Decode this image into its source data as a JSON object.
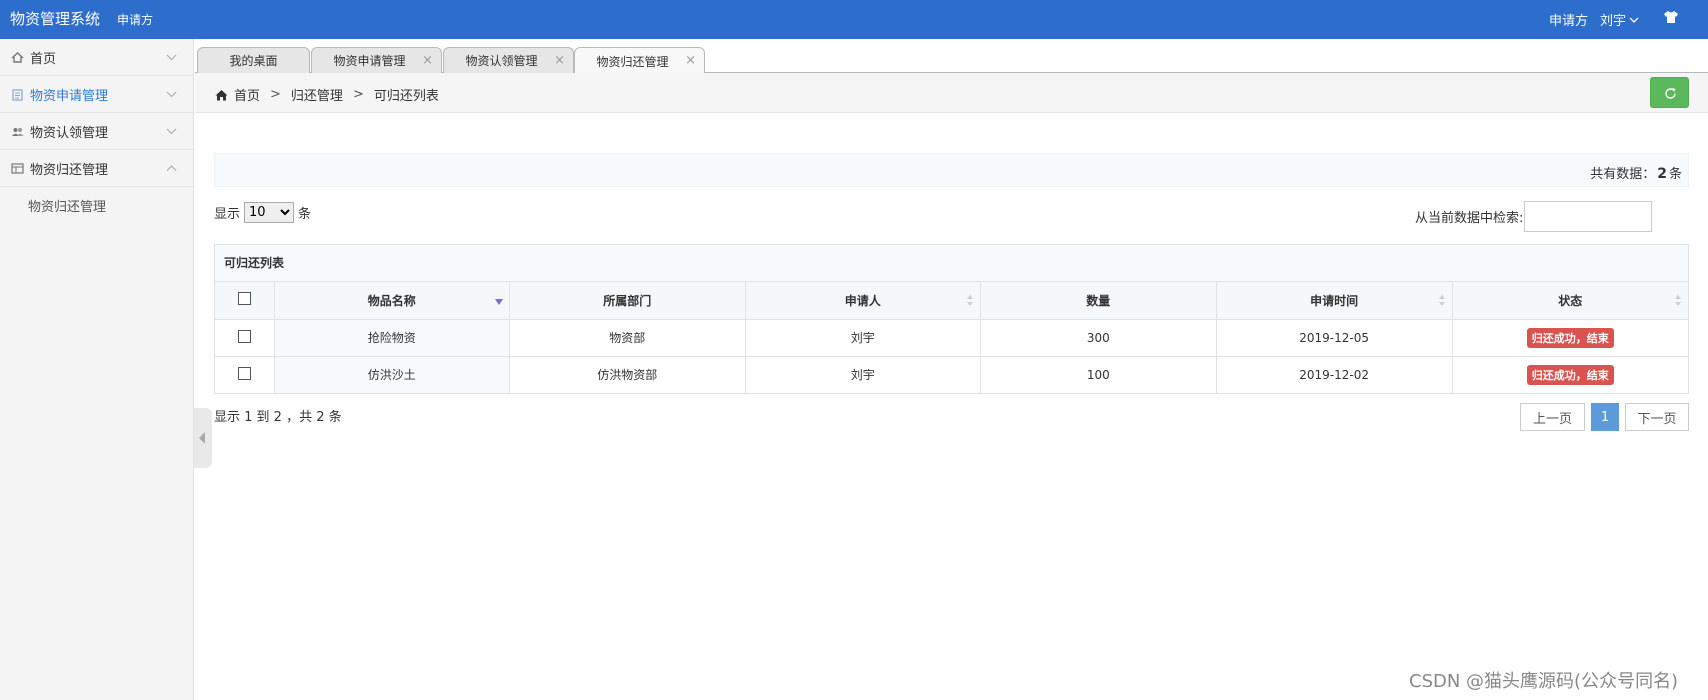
{
  "header": {
    "title": "物资管理系统",
    "role": "申请方",
    "right_role": "申请方",
    "user": "刘宇"
  },
  "sidebar": {
    "items": [
      {
        "label": "首页",
        "icon": "home-icon"
      },
      {
        "label": "物资申请管理",
        "icon": "clipboard-icon"
      },
      {
        "label": "物资认领管理",
        "icon": "users-icon"
      },
      {
        "label": "物资归还管理",
        "icon": "table-icon"
      }
    ],
    "sub_items": [
      {
        "label": "物资归还管理"
      }
    ]
  },
  "tabs": [
    {
      "label": "我的桌面"
    },
    {
      "label": "物资申请管理",
      "close": "×"
    },
    {
      "label": "物资认领管理",
      "close": "×"
    },
    {
      "label": "物资归还管理",
      "close": "×"
    }
  ],
  "breadcrumb": {
    "home": "首页",
    "sep1": ">",
    "level2": "归还管理",
    "sep2": ">",
    "level3": "可归还列表"
  },
  "summary": {
    "prefix": "共有数据：",
    "count": "2",
    "suffix": "条"
  },
  "length": {
    "prefix": "显示",
    "value": "10",
    "suffix": "条"
  },
  "search": {
    "label": "从当前数据中检索:",
    "value": ""
  },
  "table": {
    "caption": "可归还列表",
    "headers": [
      "物品名称",
      "所属部门",
      "申请人",
      "数量",
      "申请时间",
      "状态"
    ],
    "rows": [
      {
        "name": "抢险物资",
        "dept": "物资部",
        "applicant": "刘宇",
        "qty": "300",
        "date": "2019-12-05",
        "status": "归还成功，结束"
      },
      {
        "name": "仿洪沙土",
        "dept": "仿洪物资部",
        "applicant": "刘宇",
        "qty": "100",
        "date": "2019-12-02",
        "status": "归还成功，结束"
      }
    ]
  },
  "pagination": {
    "info": "显示 1 到 2 ，共 2 条",
    "prev": "上一页",
    "current": "1",
    "next": "下一页"
  },
  "watermark": "CSDN @猫头鹰源码(公众号同名)",
  "colors": {
    "header_bg": "#2d6dcc",
    "active_link": "#2d7bd6",
    "refresh_btn": "#5cb85c",
    "status_badge": "#d9534f",
    "page_current": "#5b9bdc"
  }
}
